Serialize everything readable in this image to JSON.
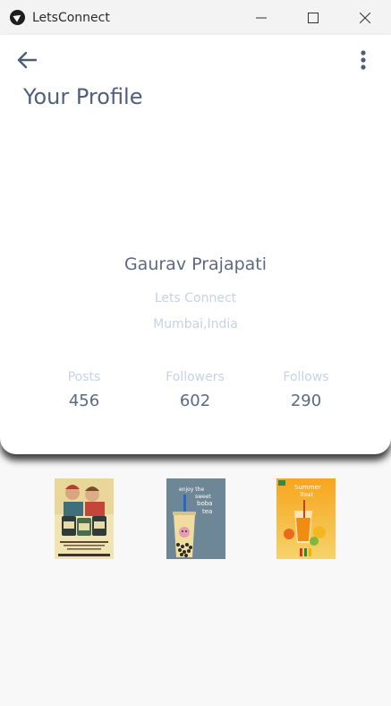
{
  "window": {
    "title": "LetsConnect"
  },
  "header": {
    "title": "Your Profile"
  },
  "profile": {
    "name": "Gaurav Prajapati",
    "tagline": "Lets Connect",
    "location": "Mumbai,India"
  },
  "stats": [
    {
      "label": "Posts",
      "value": "456"
    },
    {
      "label": "Followers",
      "value": "602"
    },
    {
      "label": "Follows",
      "value": "290"
    }
  ],
  "posts": [
    {
      "icon": "retro-poster-image",
      "caption_lines": []
    },
    {
      "icon": "bubble-tea-image",
      "caption_lines": [
        "enjoy the",
        "sweet",
        "boba",
        "tea"
      ]
    },
    {
      "icon": "summer-drink-image",
      "caption_lines": [
        "Summer",
        "Treat"
      ]
    }
  ],
  "colors": {
    "title_text": "#505f7a",
    "muted_text": "#c7d2e3",
    "value_text": "#5b6a84"
  }
}
